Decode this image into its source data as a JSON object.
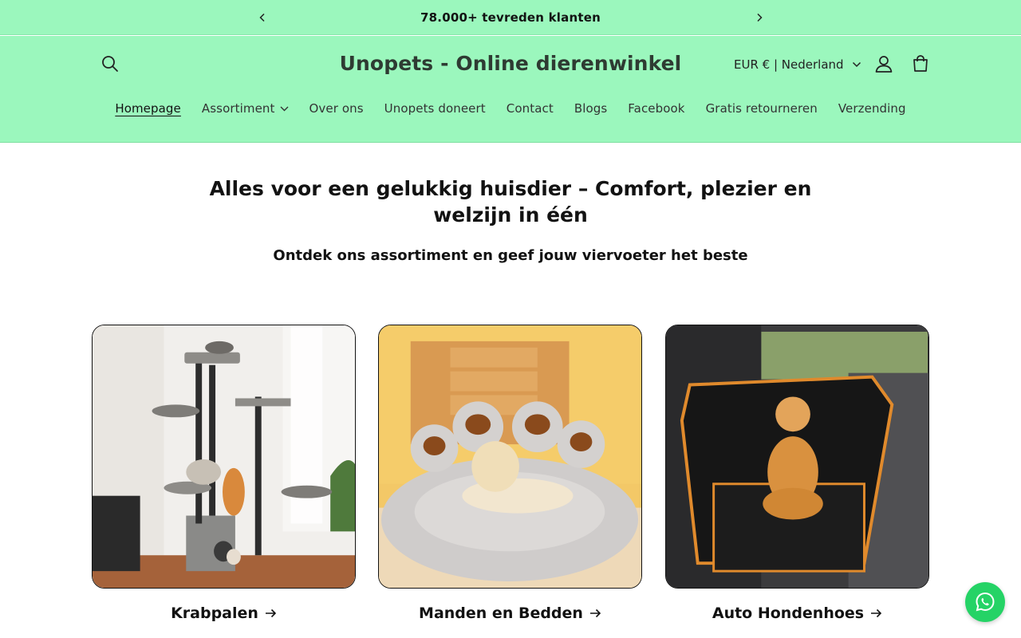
{
  "colors": {
    "brand": "#9bf7bd",
    "text": "#121212",
    "whatsapp": "#25d366"
  },
  "announcement": {
    "text": "78.000+ tevreden klanten",
    "prev_icon": "chevron-left-icon",
    "next_icon": "chevron-right-icon"
  },
  "header": {
    "logo": "Unopets - Online dierenwinkel",
    "currency": "EUR € | Nederland",
    "search_icon": "search-icon",
    "account_icon": "user-icon",
    "cart_icon": "cart-icon"
  },
  "nav": {
    "items": [
      {
        "label": "Homepage",
        "active": true
      },
      {
        "label": "Assortiment",
        "dropdown": true
      },
      {
        "label": "Over ons"
      },
      {
        "label": "Unopets doneert"
      },
      {
        "label": "Contact"
      },
      {
        "label": "Blogs"
      },
      {
        "label": "Facebook"
      },
      {
        "label": "Gratis retourneren"
      },
      {
        "label": "Verzending"
      }
    ]
  },
  "hero": {
    "title": "Alles voor een gelukkig huisdier – Comfort, plezier en welzijn in één",
    "subtitle": "Ontdek ons assortiment en geef jouw viervoeter het beste"
  },
  "collections": [
    {
      "label": "Krabpalen",
      "image": "cat-tree-image"
    },
    {
      "label": "Manden en Bedden",
      "image": "dog-bed-image"
    },
    {
      "label": "Auto Hondenhoes",
      "image": "car-seat-cover-image"
    }
  ],
  "whatsapp_icon": "whatsapp-icon"
}
